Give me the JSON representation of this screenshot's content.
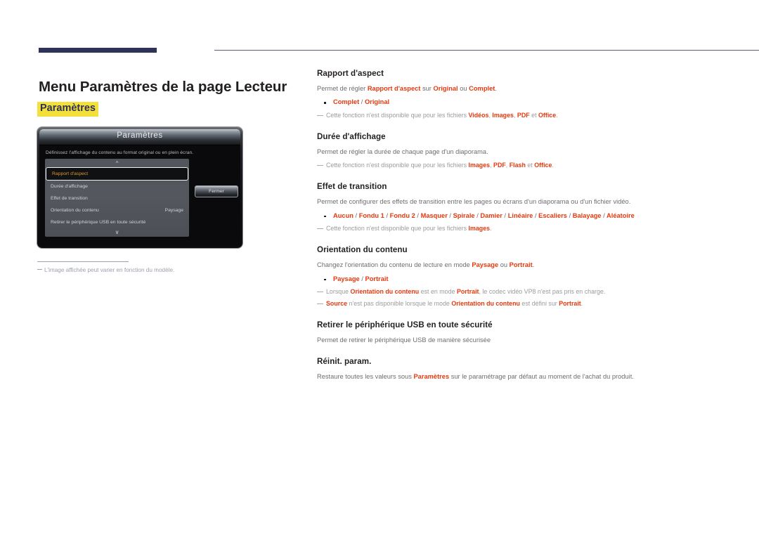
{
  "colors": {
    "accent_red": "#e8380d",
    "navy": "#2e3158",
    "highlight_yellow": "#f3e03b",
    "heading": "#231f20",
    "body": "#6d6e71",
    "note": "#9a9b9e",
    "osd_selected_text": "#e0952e"
  },
  "page": {
    "title": "Menu Paramètres de la page Lecteur",
    "subtitle": "Paramètres"
  },
  "tv_mock": {
    "osd_title": "Paramètres",
    "osd_description": "Définissez l'affichage du contenu au format original ou en plein écran.",
    "scroll_up_icon": "chevron-up-icon",
    "scroll_down_icon": "chevron-down-icon",
    "close_button": "Fermer",
    "menu_items": [
      {
        "label": "Rapport d'aspect",
        "value": "",
        "selected": true
      },
      {
        "label": "Durée d'affichage",
        "value": "",
        "selected": false
      },
      {
        "label": "Effet de transition",
        "value": "",
        "selected": false
      },
      {
        "label": "Orientation du contenu",
        "value": "Paysage",
        "selected": false
      },
      {
        "label": "Retirer le périphérique USB en toute sécurité",
        "value": "",
        "selected": false
      }
    ],
    "footnote": "L'image affichée peut varier en fonction du modèle."
  },
  "sections": [
    {
      "heading": "Rapport d'aspect",
      "description_html": "Permet de régler <b>Rapport d'aspect</b> sur <b>Original</b> ou <b>Complet</b>.",
      "options_html": "<b>Complet</b> <span class=\"sep\">/</span> <b>Original</b>",
      "notes_html": [
        "Cette fonction n'est disponible que pour les fichiers <b>Vidéos</b>, <b>Images</b>, <b>PDF</b> et <b>Office</b>."
      ]
    },
    {
      "heading": "Durée d'affichage",
      "description_html": "Permet de régler la durée de chaque page d'un diaporama.",
      "options_html": "",
      "notes_html": [
        "Cette fonction n'est disponible que pour les fichiers <b>Images</b>, <b>PDF</b>, <b>Flash</b> et <b>Office</b>."
      ]
    },
    {
      "heading": "Effet de transition",
      "description_html": "Permet de configurer des effets de transition entre les pages ou écrans d'un diaporama ou d'un fichier vidéo.",
      "options_html": "<b>Aucun</b> <span class=\"sep\">/</span> <b>Fondu 1</b> <span class=\"sep\">/</span> <b>Fondu 2</b> <span class=\"sep\">/</span> <b>Masquer</b> <span class=\"sep\">/</span> <b>Spirale</b> <span class=\"sep\">/</span> <b>Damier</b> <span class=\"sep\">/</span> <b>Linéaire</b> <span class=\"sep\">/</span> <b>Escaliers</b> <span class=\"sep\">/</span> <b>Balayage</b> <span class=\"sep\">/</span> <b>Aléatoire</b>",
      "notes_html": [
        "Cette fonction n'est disponible que pour les fichiers <b>Images</b>."
      ]
    },
    {
      "heading": "Orientation du contenu",
      "description_html": "Changez l'orientation du contenu de lecture en mode <b>Paysage</b> ou <b>Portrait</b>.",
      "options_html": "<b>Paysage</b> <span class=\"sep\">/</span> <b>Portrait</b>",
      "notes_html": [
        "Lorsque <b>Orientation du contenu</b> est en mode <b>Portrait</b>, le codec vidéo VP8 n'est pas pris en charge.",
        "<b>Source</b> n'est pas disponible lorsque le mode <b>Orientation du contenu</b> est défini sur <b>Portrait</b>."
      ]
    },
    {
      "heading": "Retirer le périphérique USB en toute sécurité",
      "description_html": "Permet de retirer le périphérique USB de manière sécurisée",
      "options_html": "",
      "notes_html": []
    },
    {
      "heading": "Réinit. param.",
      "description_html": "Restaure toutes les valeurs sous <b>Paramètres</b> sur le paramétrage par défaut au moment de l'achat du produit.",
      "options_html": "",
      "notes_html": []
    }
  ]
}
